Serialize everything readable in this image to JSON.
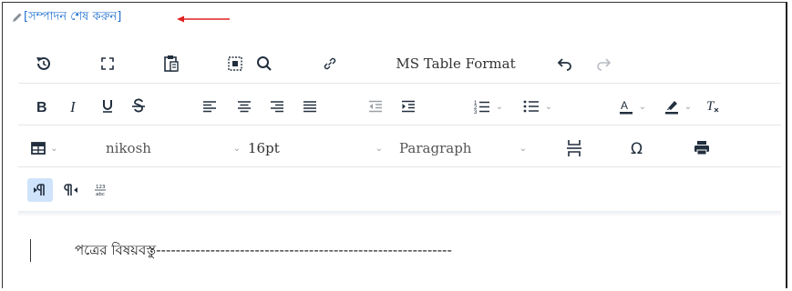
{
  "edit_link": {
    "label": "[সম্পাদন শেষ করুন]"
  },
  "toolbar": {
    "ms_table_format": "MS Table Format",
    "font_family": "nikosh",
    "font_size": "16pt",
    "block_format": "Paragraph"
  },
  "editor": {
    "body_text": "পত্রের বিষয়বস্তু------------------------------------------------------------"
  },
  "colors": {
    "link": "#1f6fd0",
    "arrow": "#e02020",
    "active": "#cfe3fb",
    "icon": "#222f3e"
  }
}
